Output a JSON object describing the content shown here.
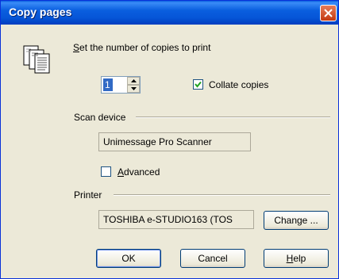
{
  "window": {
    "title": "Copy pages",
    "close_icon": "close-icon",
    "titlebar_color": "#0a5fdf",
    "background_color": "#ece9d8"
  },
  "copies": {
    "icon": "copy-pages-icon",
    "label_accel": "S",
    "label_rest": "et the number of copies to print",
    "value": "1",
    "collate_label": "Collate copies",
    "collate_checked": true
  },
  "scan_device": {
    "section_label": "Scan device",
    "device_name": "Unimessage Pro Scanner",
    "advanced_accel": "A",
    "advanced_rest": "dvanced",
    "advanced_checked": false
  },
  "printer": {
    "section_label": "Printer",
    "printer_name": "TOSHIBA e-STUDIO163 (TOS",
    "change_label": "Change ..."
  },
  "buttons": {
    "ok_label": "OK",
    "cancel_label": "Cancel",
    "help_accel": "H",
    "help_rest": "elp"
  }
}
